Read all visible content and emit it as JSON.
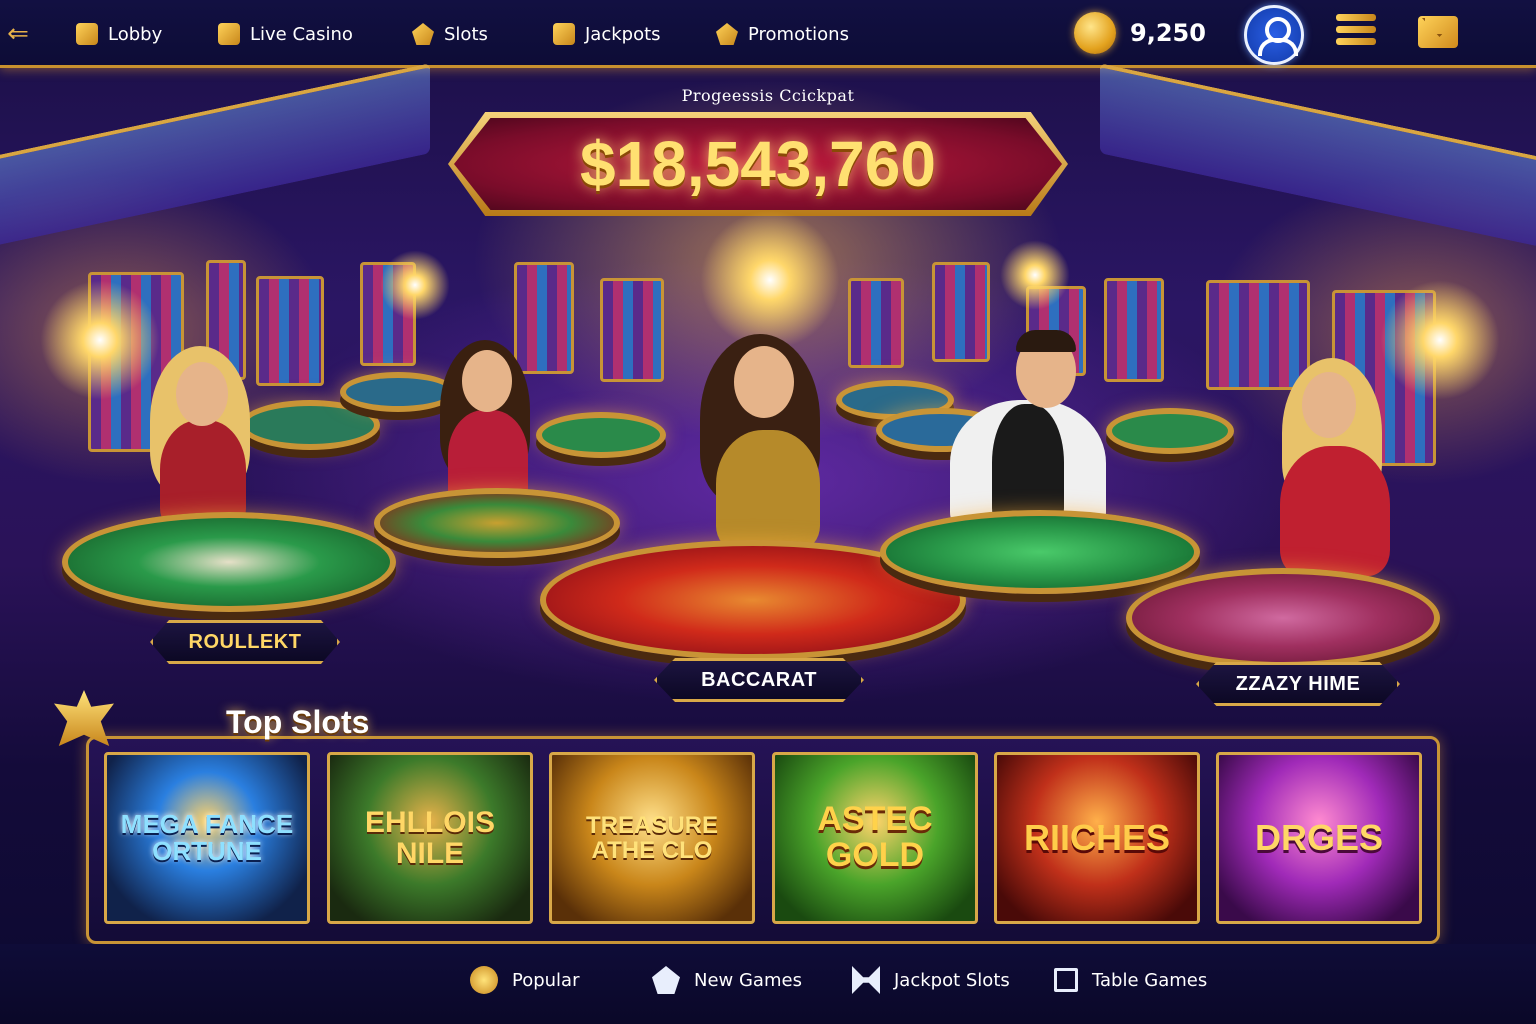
{
  "nav": {
    "back_icon": "back-arrow-icon",
    "items": [
      {
        "label": "Lobby",
        "icon": "lobby-icon"
      },
      {
        "label": "Live Casino",
        "icon": "live-casino-icon"
      },
      {
        "label": "Slots",
        "icon": "slots-icon"
      },
      {
        "label": "Jackpots",
        "icon": "jackpots-icon"
      },
      {
        "label": "Promotions",
        "icon": "promotions-icon"
      }
    ],
    "balance": "9,250",
    "coins_icon": "coins-icon",
    "profile_icon": "user-profile-icon",
    "menu_icon": "menu-icon",
    "mail_icon": "mail-icon"
  },
  "jackpot": {
    "label": "Progeessis Ccickpat",
    "amount": "$18,543,760"
  },
  "live_tables": [
    {
      "label": "ROULLEKT"
    },
    {
      "label": "BACCARAT"
    },
    {
      "label": "ZZAZY HIME"
    }
  ],
  "top_slots": {
    "title": "Top Slots",
    "games": [
      {
        "title": "MEGA FANCE ORTUNE",
        "color": "#2a7fe0"
      },
      {
        "title": "EHLLOIS NILE",
        "color": "#3c7a2a"
      },
      {
        "title": "TREASURE ATHE CLO",
        "color": "#c9861a"
      },
      {
        "title": "ASTEC GOLD",
        "color": "#4aa42a"
      },
      {
        "title": "RIICHES",
        "color": "#c0301a"
      },
      {
        "title": "DRGES",
        "color": "#a02ab8"
      }
    ]
  },
  "bottom_nav": [
    {
      "label": "Popular",
      "icon": "trophy-icon"
    },
    {
      "label": "New Games",
      "icon": "new-games-icon"
    },
    {
      "label": "Jackpot Slots",
      "icon": "jackpot-slots-icon"
    },
    {
      "label": "Table Games",
      "icon": "table-games-icon"
    }
  ],
  "colors": {
    "gold": "#d8a848",
    "jackpot_red": "#c21a3e",
    "nav_bg": "#121042",
    "profile_blue": "#2a5fe6"
  }
}
